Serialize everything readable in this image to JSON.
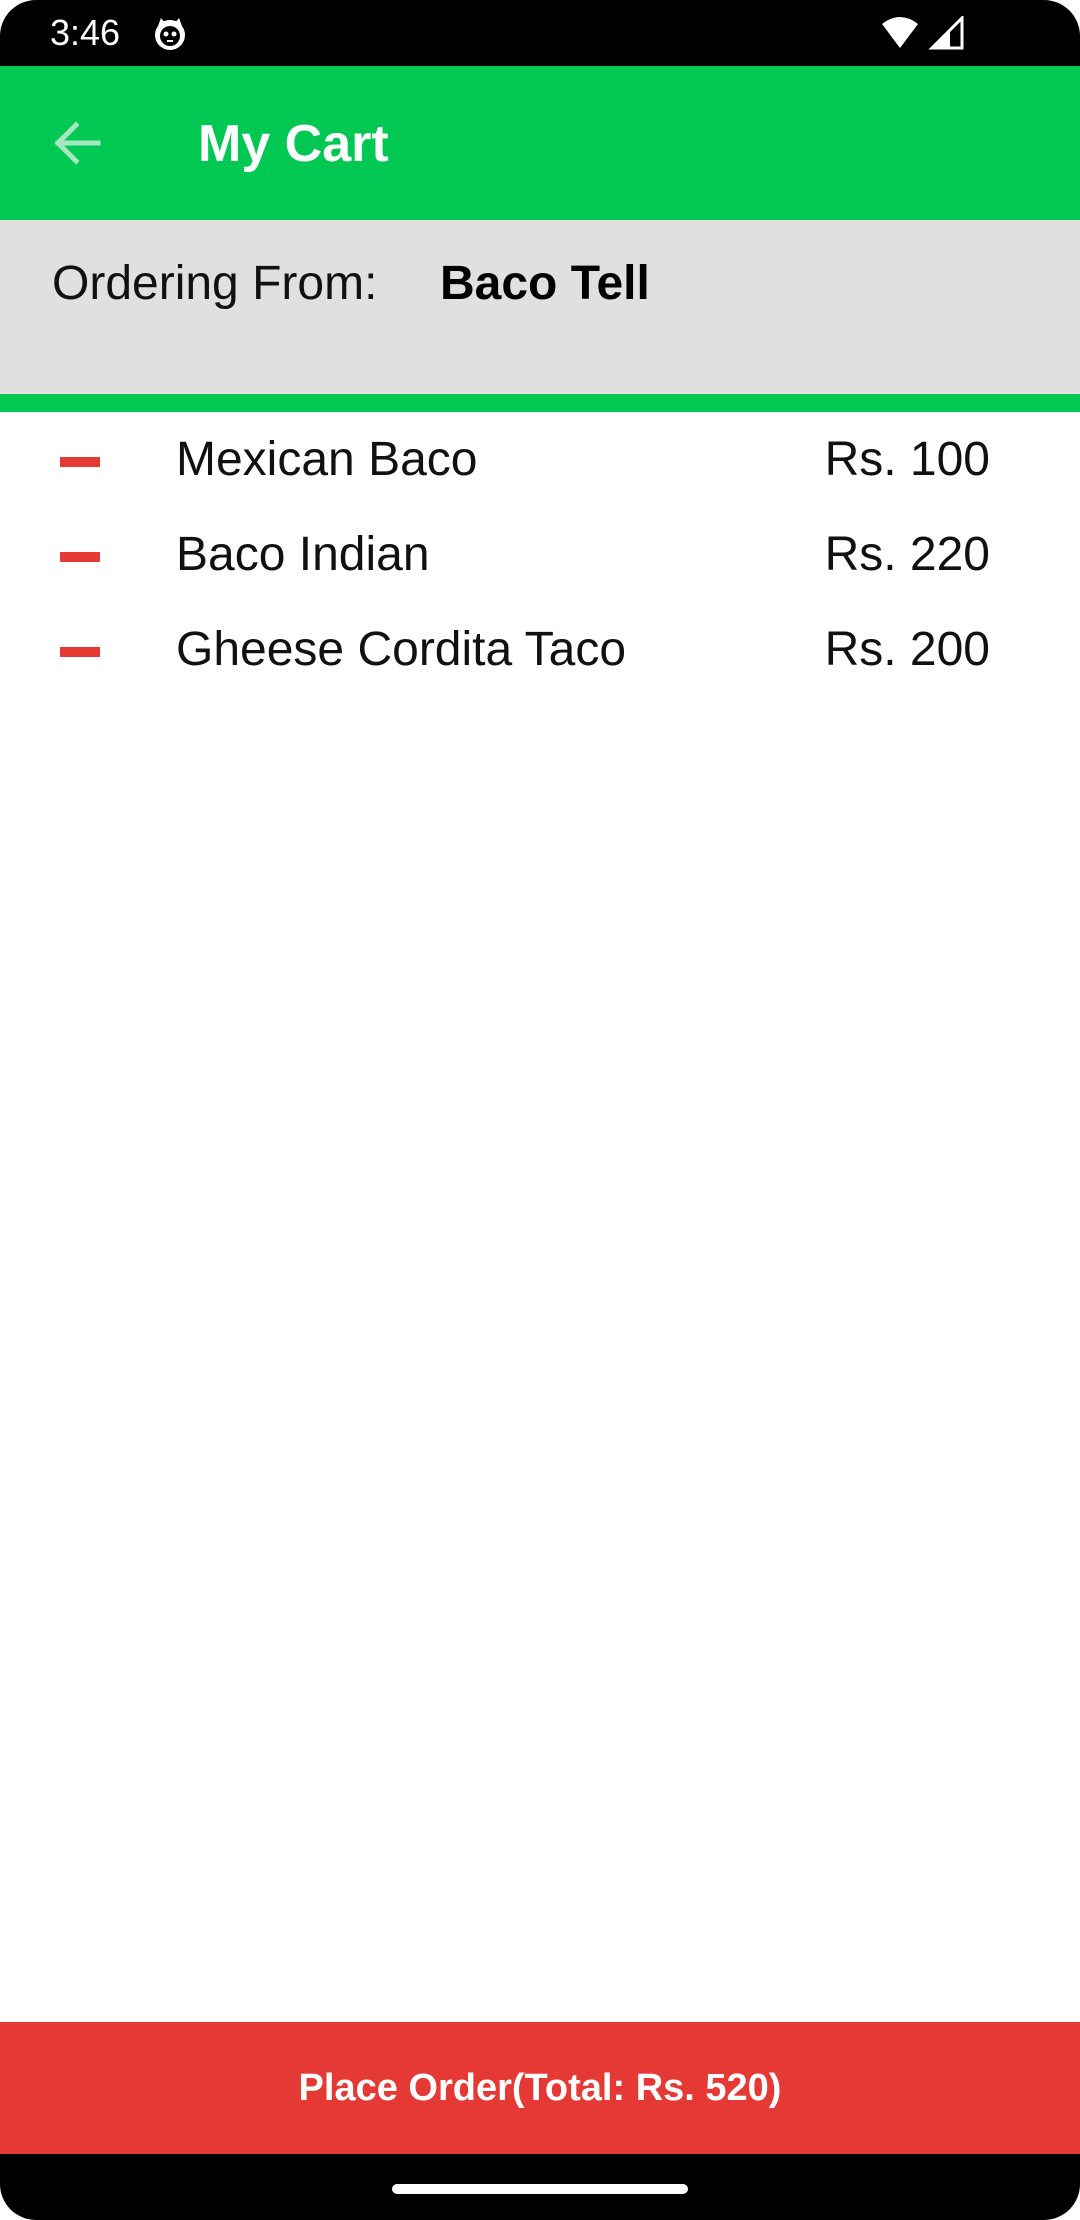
{
  "status_bar": {
    "time": "3:46",
    "app_icon": "cat-face-icon",
    "wifi_icon": "wifi-icon",
    "signal_icon": "cell-signal-icon"
  },
  "app_bar": {
    "title": "My Cart",
    "back_icon": "arrow-back-icon",
    "background": "#00c853"
  },
  "ordering": {
    "label": "Ordering From:",
    "restaurant": "Baco Tell"
  },
  "cart": {
    "items": [
      {
        "name": "Mexican Baco",
        "price": "Rs. 100",
        "remove_icon": "remove-icon"
      },
      {
        "name": "Baco Indian",
        "price": "Rs. 220",
        "remove_icon": "remove-icon"
      },
      {
        "name": "Gheese Cordita Taco",
        "price": "Rs. 200",
        "remove_icon": "remove-icon"
      }
    ]
  },
  "place_order": {
    "label": "Place Order(Total: Rs. 520)",
    "background": "#e53935"
  },
  "colors": {
    "accent_green": "#00c853",
    "danger_red": "#e53935",
    "panel_gray": "#e0e0e0"
  }
}
